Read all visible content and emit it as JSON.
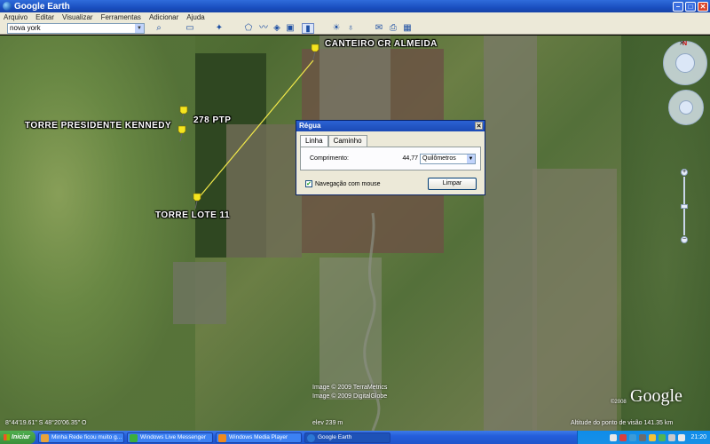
{
  "window": {
    "title": "Google Earth"
  },
  "menu": [
    "Arquivo",
    "Editar",
    "Visualizar",
    "Ferramentas",
    "Adicionar",
    "Ajuda"
  ],
  "search": {
    "value": "nova york"
  },
  "map": {
    "placemarks": [
      {
        "label": "CANTEIRO CR ALMEIDA"
      },
      {
        "label": "TORRE PRESIDENTE KENNEDY"
      },
      {
        "label": "278 PTP"
      },
      {
        "label": "TORRE LOTE 11"
      }
    ],
    "attribution": [
      "Image © 2009 TerraMetrics",
      "Image © 2009 DigitalGlobe"
    ],
    "copyright_small": "©2008",
    "brand": "Google",
    "coords": "8°44'19.61\" S   48°20'06.35\" O",
    "elevation": "elev  239 m",
    "eye_altitude": "Altitude do ponto de visão  141.35 km"
  },
  "ruler_dialog": {
    "title": "Régua",
    "tabs": [
      "Linha",
      "Caminho"
    ],
    "length_label": "Comprimento:",
    "length_value": "44,77",
    "unit": "Quilômetros",
    "mouse_nav_label": "Navegação com mouse",
    "clear_button": "Limpar"
  },
  "taskbar": {
    "start": "Iniciar",
    "tasks": [
      "Minha Rede ficou muito g...",
      "Windows Live Messenger",
      "Windows Media Player",
      "Google Earth"
    ],
    "clock": "21:20"
  },
  "colors": {
    "ruler_line": "#f2e94a",
    "pin": "#f5e51f",
    "taskbar": "#245edb"
  }
}
